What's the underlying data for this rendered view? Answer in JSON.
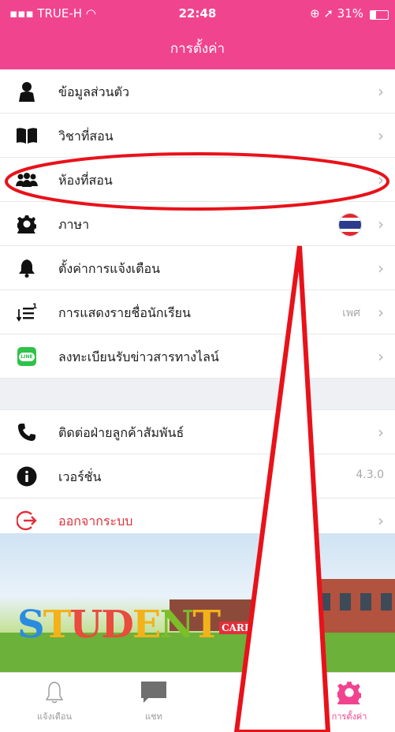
{
  "status": {
    "carrier": "TRUE-H",
    "time": "22:48",
    "battery": "31%"
  },
  "nav": {
    "title": "การตั้งค่า"
  },
  "settings": {
    "group1": [
      {
        "label": "ข้อมูลส่วนตัว",
        "icon": "person-icon",
        "value": ""
      },
      {
        "label": "วิชาที่สอน",
        "icon": "book-icon",
        "value": ""
      },
      {
        "label": "ห้องที่สอน",
        "icon": "group-icon",
        "value": ""
      },
      {
        "label": "ภาษา",
        "icon": "gear-icon",
        "value": "thai-flag"
      },
      {
        "label": "ตั้งค่าการแจ้งเตือน",
        "icon": "bell-icon",
        "value": ""
      },
      {
        "label": "การแสดงรายชื่อนักเรียน",
        "icon": "sort-icon",
        "value": "เพศ"
      },
      {
        "label": "ลงทะเบียนรับข่าวสารทางไลน์",
        "icon": "line-icon",
        "value": ""
      }
    ],
    "group2": [
      {
        "label": "ติดต่อฝ่ายลูกค้าสัมพันธ์",
        "icon": "phone-icon",
        "value": ""
      },
      {
        "label": "เวอร์ชั่น",
        "icon": "info-icon",
        "value": "4.3.0"
      },
      {
        "label": "ออกจากระบบ",
        "icon": "logout-icon",
        "value": ""
      }
    ],
    "line_icon_text": "LINE"
  },
  "banner": {
    "logo_letters": [
      "S",
      "T",
      "U",
      "D",
      "E",
      "N",
      "T"
    ],
    "logo_sub": "CARE"
  },
  "tabs": [
    {
      "label": "แจ้งเตือน",
      "icon": "bell-outline-icon",
      "active": false
    },
    {
      "label": "แชท",
      "icon": "chat-icon",
      "active": false
    },
    {
      "label": "การตั้งค่า",
      "icon": "gear-icon",
      "active": true
    }
  ],
  "colors": {
    "brand_pink": "#f1448f",
    "annotation_red": "#e8121a",
    "logout_red": "#e0303a"
  }
}
